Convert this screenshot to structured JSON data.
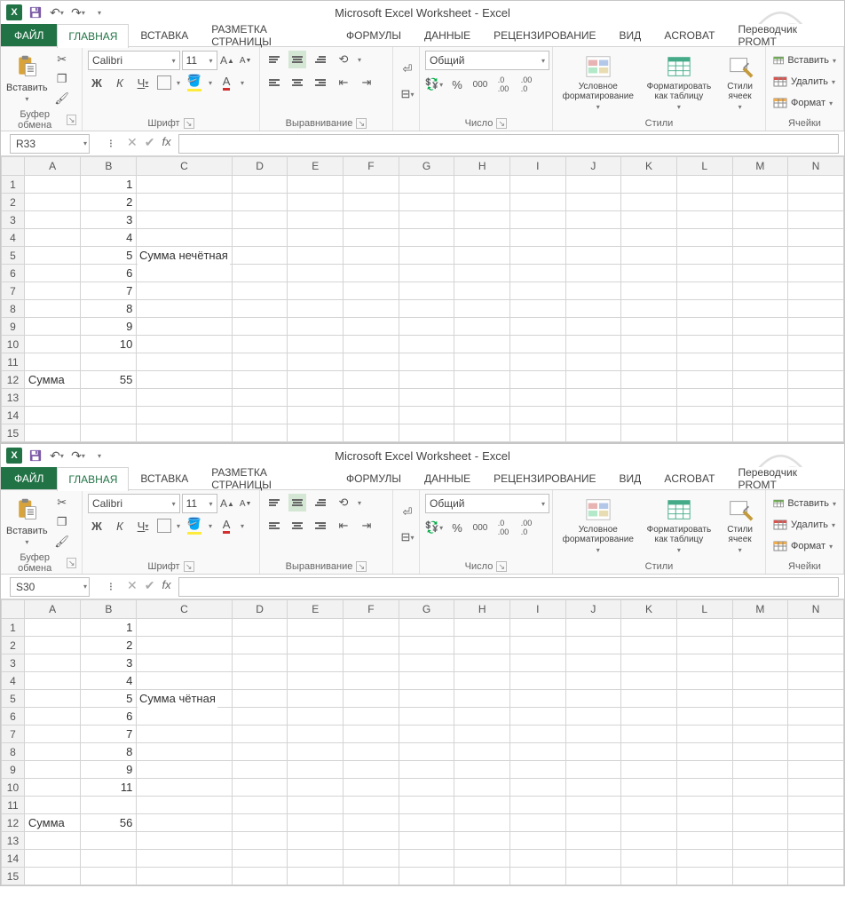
{
  "title": {
    "doc": "Microsoft Excel Worksheet",
    "app": "Excel"
  },
  "tabs": [
    "ФАЙЛ",
    "ГЛАВНАЯ",
    "ВСТАВКА",
    "РАЗМЕТКА СТРАНИЦЫ",
    "ФОРМУЛЫ",
    "ДАННЫЕ",
    "РЕЦЕНЗИРОВАНИЕ",
    "ВИД",
    "ACROBAT",
    "Переводчик PROMT"
  ],
  "ribbon": {
    "clipboard": {
      "paste": "Вставить",
      "label": "Буфер обмена"
    },
    "font": {
      "name": "Calibri",
      "size": "11",
      "label": "Шрифт",
      "b": "Ж",
      "i": "К",
      "u": "Ч"
    },
    "align": {
      "label": "Выравнивание"
    },
    "number": {
      "format": "Общий",
      "label": "Число",
      "percent": "%",
      "comma": "000"
    },
    "styles": {
      "cond": "Условное форматирование",
      "table": "Форматировать как таблицу",
      "cell": "Стили ячеек",
      "label": "Стили"
    },
    "cells": {
      "insert": "Вставить",
      "delete": "Удалить",
      "format": "Формат",
      "label": "Ячейки"
    }
  },
  "instances": [
    {
      "namebox": "R33",
      "columns": [
        "A",
        "B",
        "C",
        "D",
        "E",
        "F",
        "G",
        "H",
        "I",
        "J",
        "K",
        "L",
        "M",
        "N"
      ],
      "rows": 15,
      "cells": {
        "B1": "1",
        "B2": "2",
        "B3": "3",
        "B4": "4",
        "B5": "5",
        "B6": "6",
        "B7": "7",
        "B8": "8",
        "B9": "9",
        "B10": "10",
        "A12": "Сумма",
        "B12": "55",
        "C5": "Сумма нечётная"
      },
      "overflow": {
        "at": "C5",
        "text": "Сумма нечётная"
      }
    },
    {
      "namebox": "S30",
      "columns": [
        "A",
        "B",
        "C",
        "D",
        "E",
        "F",
        "G",
        "H",
        "I",
        "J",
        "K",
        "L",
        "M",
        "N"
      ],
      "rows": 15,
      "cells": {
        "B1": "1",
        "B2": "2",
        "B3": "3",
        "B4": "4",
        "B5": "5",
        "B6": "6",
        "B7": "7",
        "B8": "8",
        "B9": "9",
        "B10": "11",
        "A12": "Сумма",
        "B12": "56",
        "C5": "Сумма чётная"
      },
      "overflow": {
        "at": "C5",
        "text": "Сумма чётная"
      }
    }
  ]
}
